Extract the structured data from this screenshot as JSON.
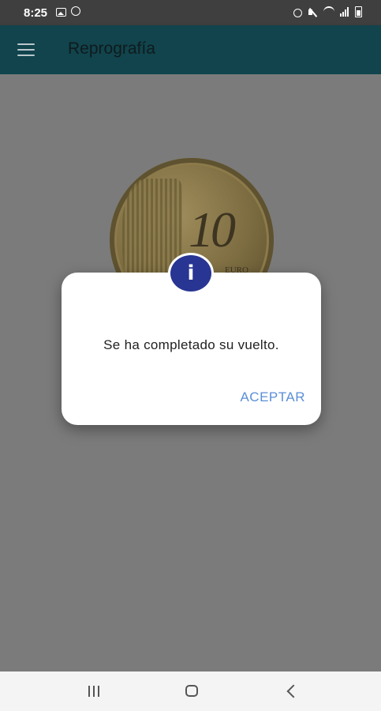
{
  "status_bar": {
    "time": "8:25",
    "left_icons": [
      "gallery-icon",
      "whatsapp-icon"
    ],
    "right_icons": [
      "alarm-icon",
      "mute-icon",
      "wifi-icon",
      "signal-icon",
      "battery-icon"
    ]
  },
  "app_bar": {
    "title": "Reprografía",
    "menu_icon": "hamburger-menu-icon",
    "background": "#11444d"
  },
  "main": {
    "image": "coin-10-euro-cent"
  },
  "dialog": {
    "icon": "info-icon",
    "icon_glyph": "i",
    "icon_color": "#283593",
    "message": "Se ha completado su vuelto.",
    "button_label": "ACEPTAR",
    "button_color": "#5b8fd6"
  },
  "nav_bar": {
    "buttons": [
      "recents-icon",
      "home-icon",
      "back-icon"
    ]
  }
}
